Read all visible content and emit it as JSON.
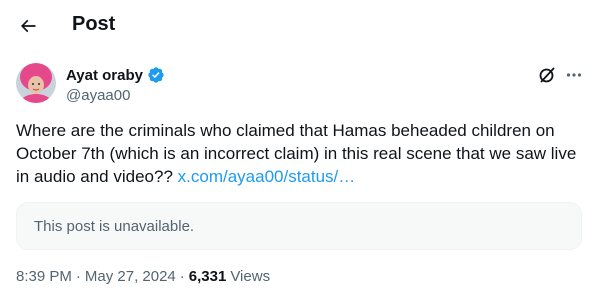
{
  "header": {
    "title": "Post",
    "back_icon": "arrow-left-icon"
  },
  "author": {
    "display_name": "Ayat oraby",
    "handle": "@ayaa00",
    "verified": true,
    "verified_color": "#1d9bf0",
    "avatar_icon": "profile-photo"
  },
  "post": {
    "text": "Where are the criminals who claimed that Hamas beheaded children on October 7th (which is an incorrect claim) in this real scene that we saw live in audio and video?? ",
    "link_text": "x.com/ayaa00/status/…",
    "quoted_card_text": "This post is unavailable."
  },
  "meta": {
    "time": "8:39 PM",
    "separator": "·",
    "date": "May 27, 2024",
    "views_count": "6,331",
    "views_label": "Views"
  },
  "actions": {
    "grok_icon": "grok-icon",
    "more_icon": "more-horizontal-icon"
  },
  "colors": {
    "text_primary": "#0f1419",
    "text_secondary": "#536471",
    "link": "#1d9bf0",
    "card_bg": "#f7f9f9"
  }
}
